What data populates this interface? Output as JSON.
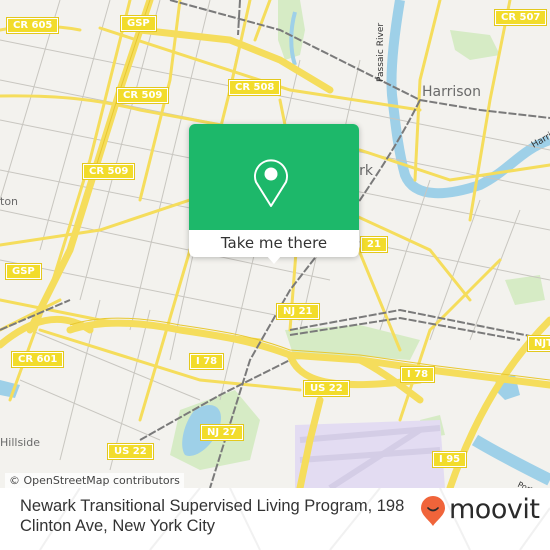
{
  "map": {
    "road_shields": [
      {
        "label": "CR 605"
      },
      {
        "label": "GSP"
      },
      {
        "label": "CR 508"
      },
      {
        "label": "CR 507"
      },
      {
        "label": "CR 509"
      },
      {
        "label": "CR 509"
      },
      {
        "label": "GSP"
      },
      {
        "label": "CR 601"
      },
      {
        "label": "I 78"
      },
      {
        "label": "NJ 21"
      },
      {
        "label": "I 78"
      },
      {
        "label": "US 22"
      },
      {
        "label": "NJ 27"
      },
      {
        "label": "US 22"
      },
      {
        "label": "I 95"
      },
      {
        "label": "NJT"
      },
      {
        "label": "21"
      },
      {
        "label": "CR 508"
      }
    ],
    "places": [
      {
        "label": "Harrison"
      },
      {
        "label": "Newark"
      },
      {
        "label": "Hillside"
      },
      {
        "label": "ton"
      },
      {
        "label": "Passaic River"
      },
      {
        "label": "Harrison"
      },
      {
        "label": "Port N"
      }
    ],
    "colors": {
      "background": "#f3f2ee",
      "road": "#f5dd5c",
      "water": "#9ed0e8",
      "park": "#d6ebc5",
      "rail": "#777777",
      "airport": "#e3dcf2"
    }
  },
  "attribution": "© OpenStreetMap contributors",
  "popup": {
    "action_label": "Take me there",
    "accent_color": "#1db86a",
    "icon": "map-pin-icon"
  },
  "footer": {
    "title": "Newark Transitional Supervised Living Program, 198 Clinton Ave, New York City",
    "brand": "moovit",
    "brand_color": "#f0643a"
  }
}
